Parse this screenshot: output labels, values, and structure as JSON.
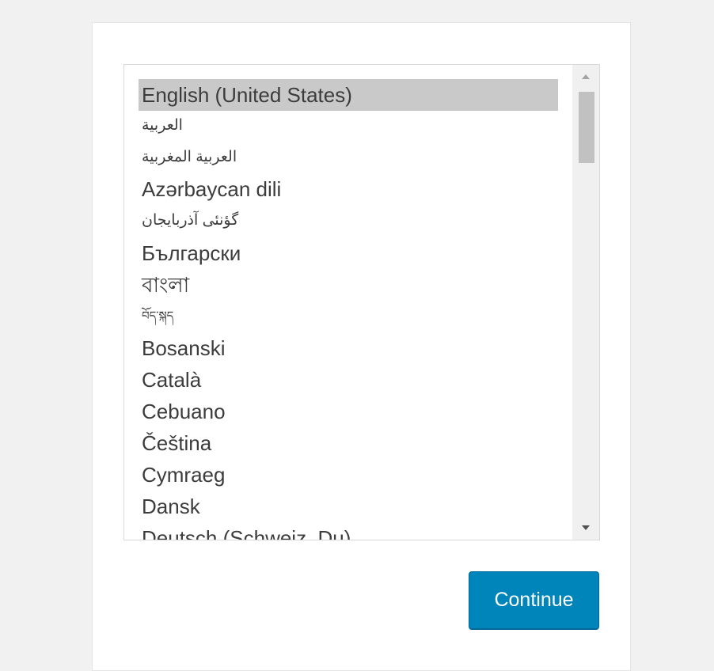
{
  "language_list": {
    "selected_index": 0,
    "items": [
      {
        "label": "English (United States)"
      },
      {
        "label": "العربية"
      },
      {
        "label": "العربية المغربية"
      },
      {
        "label": "Azərbaycan dili"
      },
      {
        "label": "گؤنئی آذربایجان"
      },
      {
        "label": "Български"
      },
      {
        "label": "বাংলা"
      },
      {
        "label": "བོད་སྐད"
      },
      {
        "label": "Bosanski"
      },
      {
        "label": "Català"
      },
      {
        "label": "Cebuano"
      },
      {
        "label": "Čeština"
      },
      {
        "label": "Cymraeg"
      },
      {
        "label": "Dansk"
      },
      {
        "label": "Deutsch (Schweiz, Du)"
      }
    ]
  },
  "scrollbar": {
    "up_icon": "triangle-up-icon",
    "down_icon": "triangle-down-icon",
    "color_track": "#f0f0f0",
    "color_thumb": "#c1c1c1"
  },
  "actions": {
    "continue_label": "Continue",
    "button_color": "#0085ba"
  }
}
